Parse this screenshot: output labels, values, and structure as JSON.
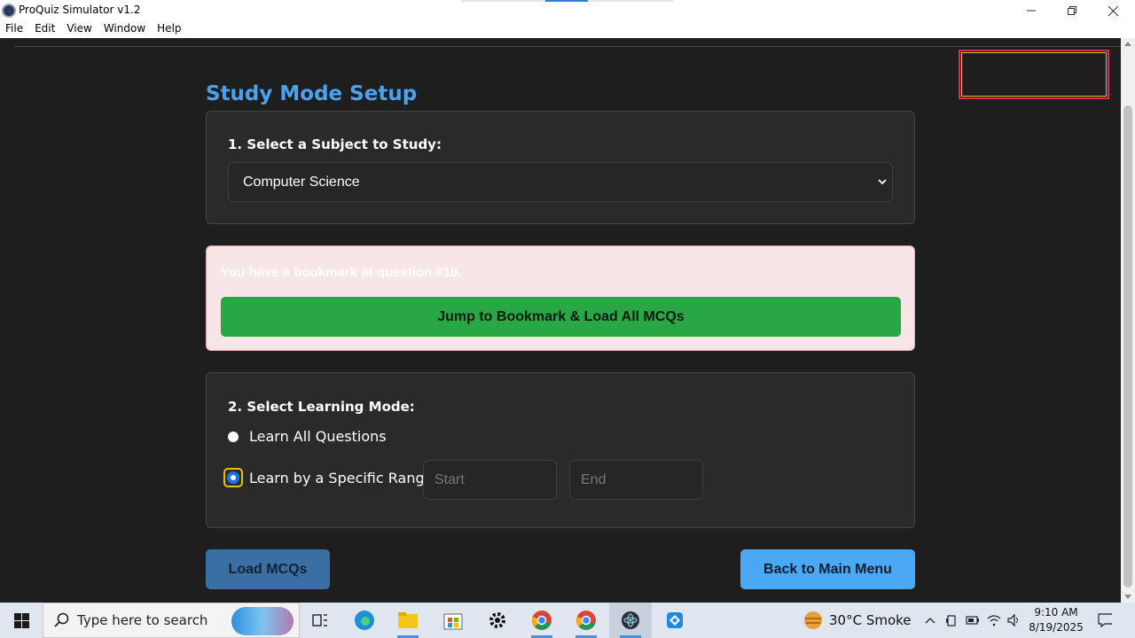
{
  "window": {
    "title": "ProQuiz Simulator v1.2"
  },
  "menu": [
    "File",
    "Edit",
    "View",
    "Window",
    "Help"
  ],
  "page": {
    "title": "Study Mode Setup",
    "subject_section": {
      "label": "1. Select a Subject to Study:",
      "selected_subject": "Computer Science"
    },
    "bookmark": {
      "message": "You have a bookmark at question #10.",
      "button": "Jump to Bookmark & Load All MCQs"
    },
    "mode_section": {
      "label": "2. Select Learning Mode:",
      "options": [
        {
          "label": "Learn All Questions",
          "selected": false
        },
        {
          "label": "Learn by a Specific Range:",
          "selected": true
        }
      ],
      "start_placeholder": "Start",
      "end_placeholder": "End"
    },
    "load_button": "Load MCQs",
    "back_button": "Back to Main Menu"
  },
  "taskbar": {
    "search_placeholder": "Type here to search",
    "weather": "30°C  Smoke",
    "time": "9:10 AM",
    "date": "8/19/2025"
  },
  "colors": {
    "accent_title": "#4aa3f0",
    "jump_button": "#29a744",
    "back_button": "#4aa8f5",
    "load_button": "#3a6fa3",
    "bookmark_bg": "#f8e5e7"
  }
}
